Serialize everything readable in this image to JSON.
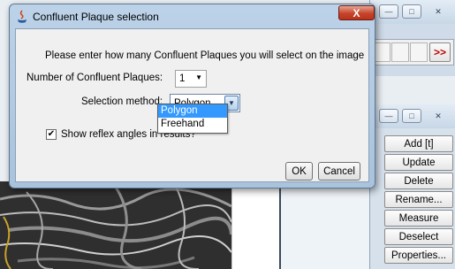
{
  "dialog": {
    "title": "Confluent Plaque selection",
    "close_label": "X",
    "prompt": "Please enter how many Confluent Plaques you will select on the image",
    "count_label": "Number of Confluent Plaques:",
    "count_value": "1",
    "method_label": "Selection method:",
    "method_value": "Polygon",
    "method_options": [
      "Polygon",
      "Freehand"
    ],
    "checkbox_label": "Show reflex angles in results?",
    "checkbox_checked": true,
    "ok_label": "OK",
    "cancel_label": "Cancel"
  },
  "background_window": {
    "arrow_label": ">>"
  },
  "roi_manager": {
    "buttons": [
      "Add [t]",
      "Update",
      "Delete",
      "Rename...",
      "Measure",
      "Deselect",
      "Properties..."
    ]
  },
  "colors": {
    "selection_highlight": "#3399ff",
    "close_button": "#c6432a",
    "title_gradient": "#bcd2e8"
  }
}
